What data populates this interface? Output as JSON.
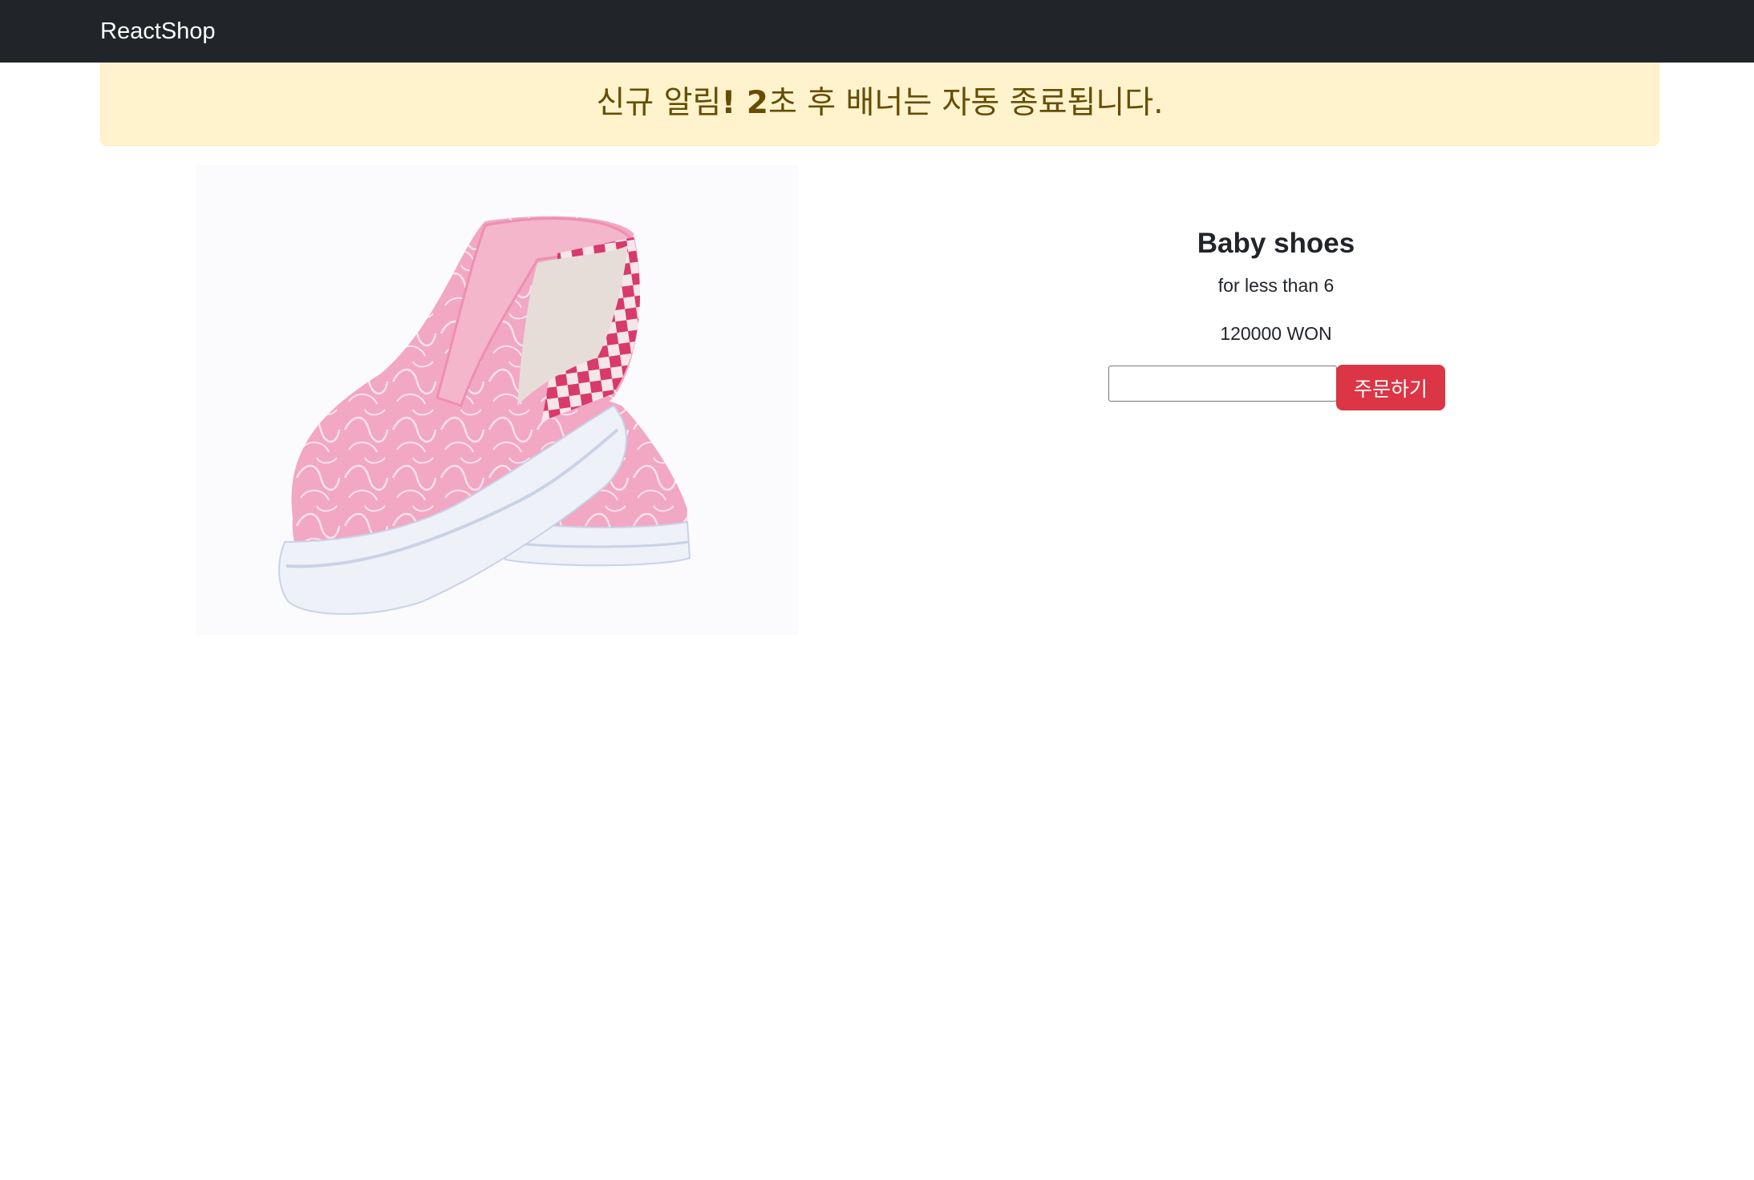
{
  "navbar": {
    "brand": "ReactShop"
  },
  "alert": {
    "prefix": "신규 알림",
    "bold": "! 2",
    "suffix": "초 후 배너는 자동 종료됩니다."
  },
  "product": {
    "image_icon": "baby-shoes-photo",
    "title": "Baby shoes",
    "description": "for less than 6",
    "price": "120000 WON",
    "quantity_value": "",
    "order_label": "주문하기"
  },
  "colors": {
    "navbar_bg": "#212529",
    "alert_bg": "#fff3cd",
    "alert_text": "#664d03",
    "order_button": "#dc3545",
    "shoe_pink": "#f2a7c3",
    "checker": "#d83a6a"
  }
}
